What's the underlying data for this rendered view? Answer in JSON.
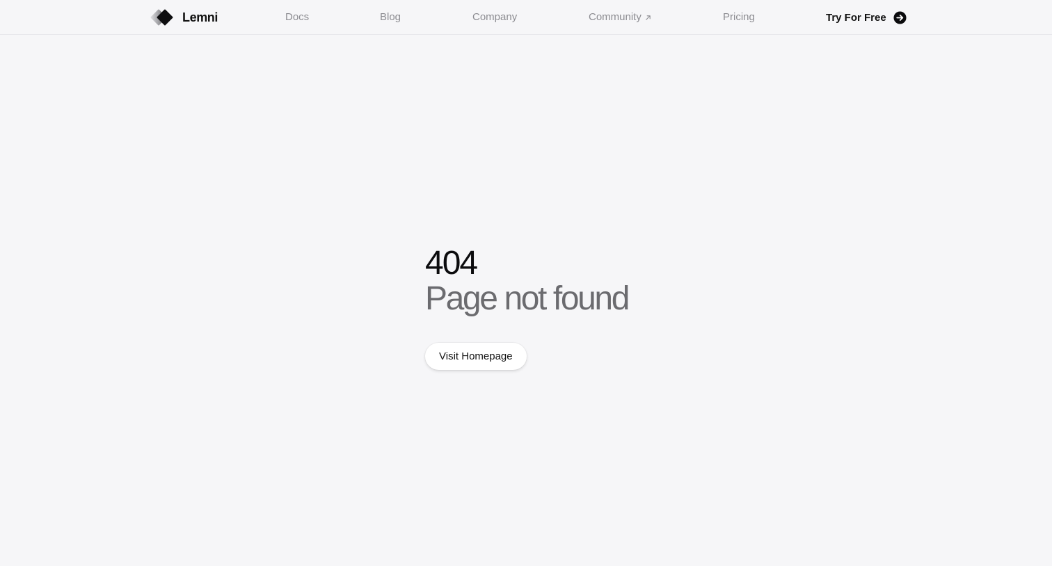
{
  "header": {
    "brand": {
      "name": "Lemni",
      "logo_icon": "lemni-logo-icon"
    },
    "nav": {
      "docs": "Docs",
      "blog": "Blog",
      "company": "Company",
      "community": "Community",
      "community_icon": "external-arrow-icon",
      "pricing": "Pricing"
    },
    "cta": {
      "label": "Try For Free",
      "icon": "arrow-right-circle-icon"
    }
  },
  "main": {
    "error_code": "404",
    "error_message": "Page not found",
    "home_button_label": "Visit Homepage"
  },
  "colors": {
    "background": "#f6f6f8",
    "nav_text": "#8c8c91",
    "primary_text": "#111111",
    "muted_heading": "#6b6b6f",
    "button_bg": "#ffffff"
  }
}
